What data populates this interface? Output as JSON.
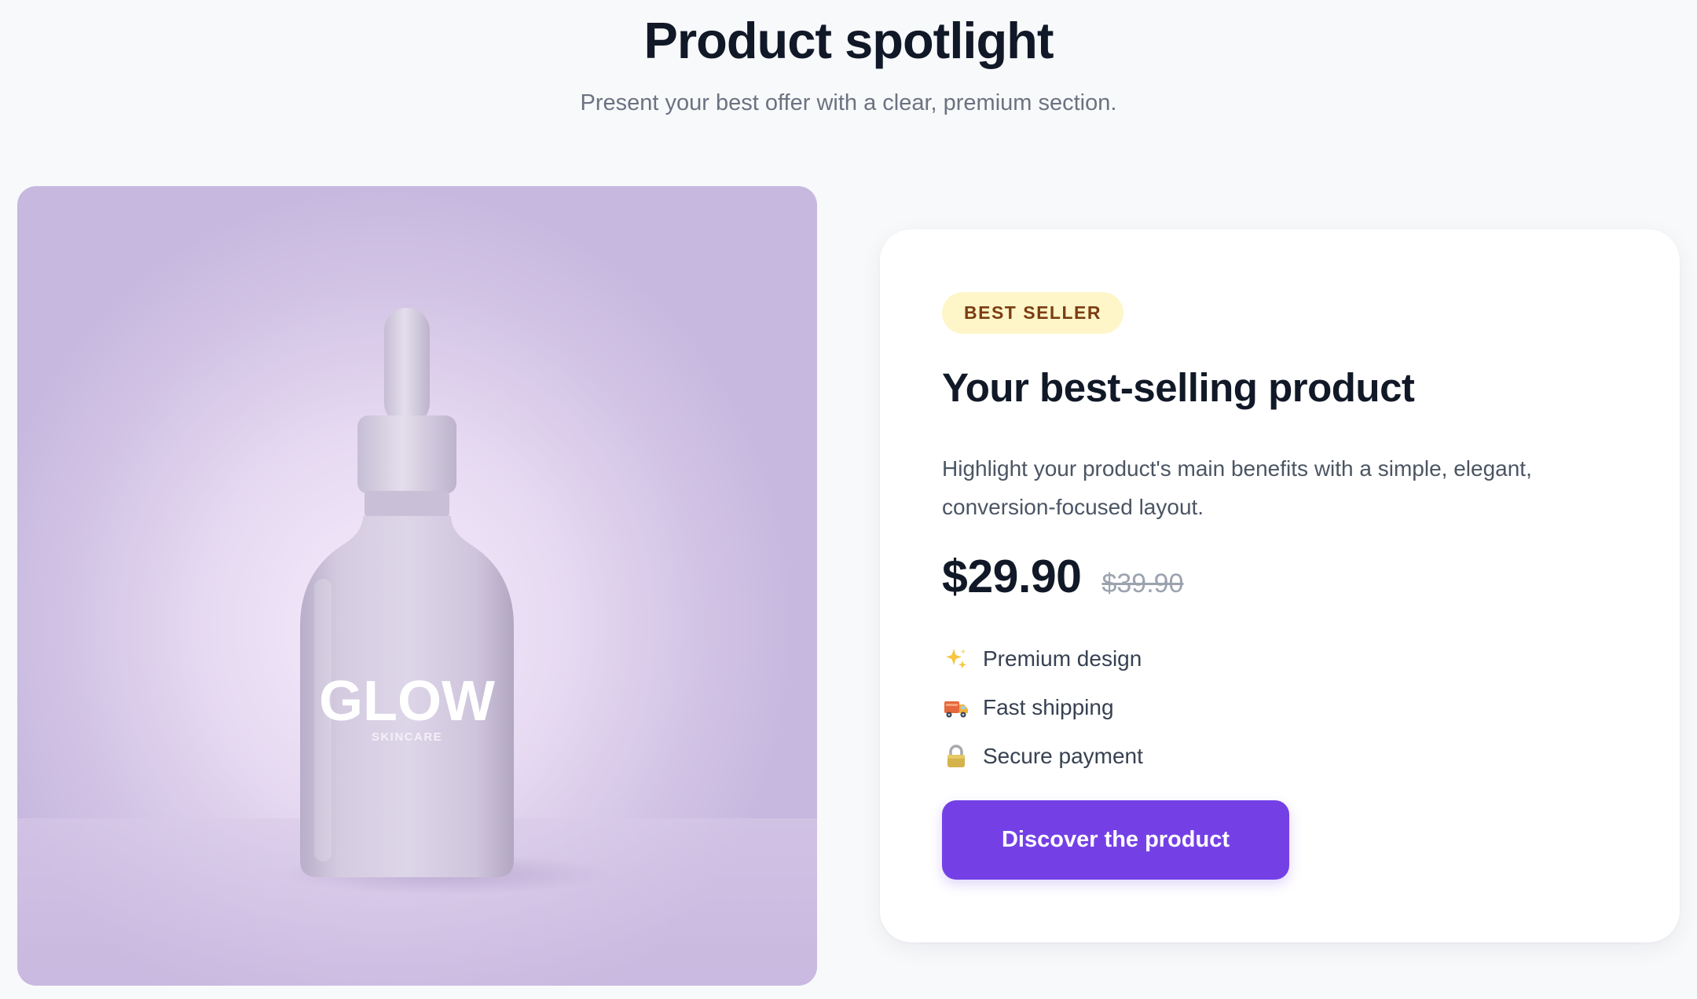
{
  "header": {
    "title": "Product spotlight",
    "subtitle": "Present your best offer with a clear, premium section."
  },
  "product_image": {
    "brand_logo": "GLOW",
    "brand_sub": "SKINCARE"
  },
  "card": {
    "badge": "BEST SELLER",
    "title": "Your best-selling product",
    "description": "Highlight your product's main benefits with a simple, elegant, conversion-focused layout.",
    "price": "$29.90",
    "old_price": "$39.90",
    "features": [
      {
        "icon": "sparkles-icon",
        "label": "Premium design"
      },
      {
        "icon": "delivery-truck-icon",
        "label": "Fast shipping"
      },
      {
        "icon": "lock-icon",
        "label": "Secure payment"
      }
    ],
    "cta_label": "Discover the product"
  },
  "colors": {
    "accent": "#7440e6",
    "badge_bg": "#fef6c8",
    "badge_text": "#7c3d12",
    "page_bg": "#f8f9fb"
  }
}
